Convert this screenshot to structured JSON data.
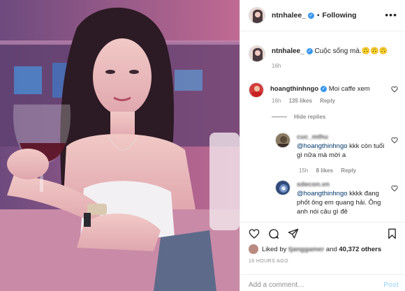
{
  "header": {
    "username": "ntnhalee_",
    "separator": "•",
    "follow_status": "Following",
    "more": "•••"
  },
  "caption": {
    "username": "ntnhalee_",
    "text": "Cuộc sống mà.🙃🙃🙃",
    "time": "16h"
  },
  "comments": [
    {
      "username": "hoangthinhngo",
      "text": "Moi caffe xem",
      "time": "16h",
      "likes": "135 likes",
      "reply": "Reply"
    }
  ],
  "hide_replies": "Hide replies",
  "replies": [
    {
      "username": "cuc_mthu",
      "mention": "@hoangthinhngo",
      "text": "kkk còn tuổi gì nữa mà mời a",
      "time": "15h",
      "likes": "8 likes",
      "reply": "Reply"
    },
    {
      "username": "xdecon.vn",
      "mention": "@hoangthinhngo",
      "text": "kkkk đang phốt ông em quang hải. Ông anh nói câu gì đê"
    }
  ],
  "actions": {
    "like": "heart-icon",
    "comment": "comment-icon",
    "share": "share-icon",
    "save": "bookmark-icon"
  },
  "likes": {
    "prefix": "Liked by",
    "user": "tjanggamer",
    "middle": "and",
    "count": "40,372 others"
  },
  "post_time": "16 HOURS AGO",
  "add_comment": {
    "placeholder": "Add a comment…",
    "post_label": "Post"
  },
  "colors": {
    "verified": "#3897f0",
    "link": "#00376b",
    "muted": "#8e8e8e",
    "post_disabled": "#b2dffc"
  }
}
